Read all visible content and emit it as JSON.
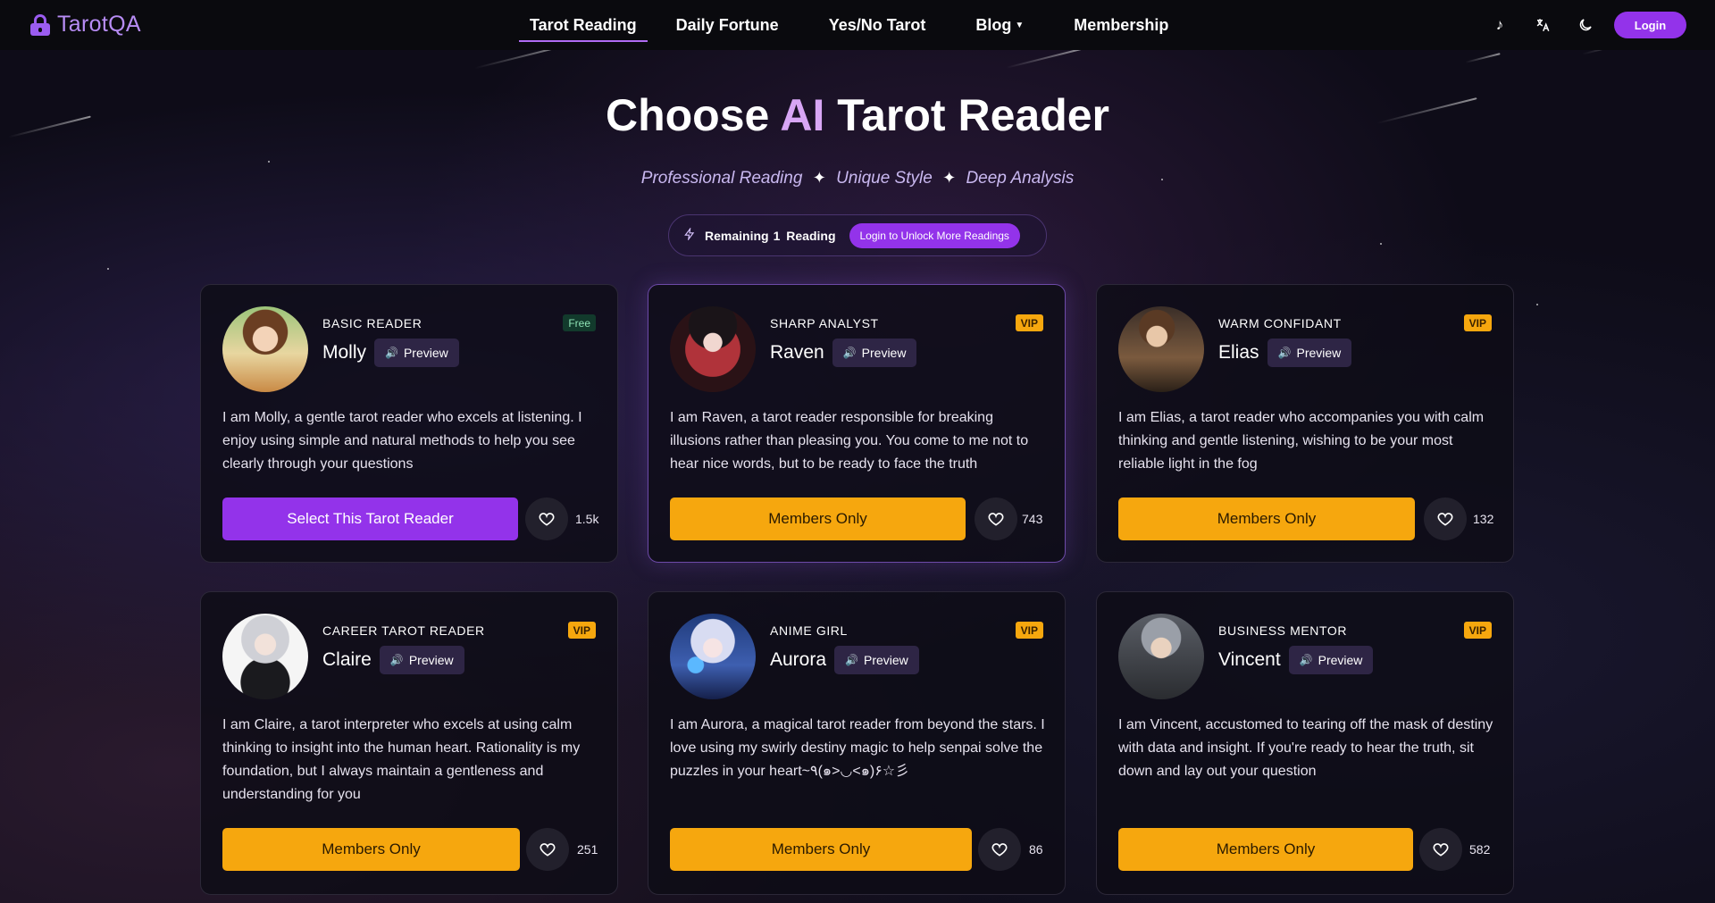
{
  "brand": {
    "name": "TarotQA"
  },
  "nav": {
    "links": [
      {
        "label": "Tarot Reading",
        "active": true
      },
      {
        "label": "Daily Fortune"
      },
      {
        "label": "Yes/No Tarot"
      },
      {
        "label": "Blog",
        "dropdown": true
      },
      {
        "label": "Membership"
      }
    ],
    "icons": [
      "music-note-icon",
      "translate-icon",
      "moon-icon"
    ],
    "login_label": "Login"
  },
  "hero": {
    "title_pre": "Choose",
    "title_accent": "AI",
    "title_post": "Tarot Reader",
    "sub_1": "Professional Reading",
    "sub_2": "Unique Style",
    "sub_3": "Deep Analysis",
    "separator": "✦",
    "remaining_label": "Remaining",
    "remaining_count": "1",
    "remaining_unit": "Reading",
    "unlock_label": "Login to Unlock More Readings"
  },
  "preview_label": "Preview",
  "readers": [
    {
      "role": "BASIC READER",
      "badge": "Free",
      "name": "Molly",
      "desc": "I am Molly, a gentle tarot reader who excels at listening. I enjoy using simple and natural methods to help you see clearly through your questions",
      "action": "Select This Tarot Reader",
      "likes": "1.5k"
    },
    {
      "role": "SHARP ANALYST",
      "badge": "VIP",
      "name": "Raven",
      "desc": "I am Raven, a tarot reader responsible for breaking illusions rather than pleasing you. You come to me not to hear nice words, but to be ready to face the truth",
      "action": "Members Only",
      "likes": "743"
    },
    {
      "role": "WARM CONFIDANT",
      "badge": "VIP",
      "name": "Elias",
      "desc": "I am Elias, a tarot reader who accompanies you with calm thinking and gentle listening, wishing to be your most reliable light in the fog",
      "action": "Members Only",
      "likes": "132"
    },
    {
      "role": "CAREER TAROT READER",
      "badge": "VIP",
      "name": "Claire",
      "desc": "I am Claire, a tarot interpreter who excels at using calm thinking to insight into the human heart. Rationality is my foundation, but I always maintain a gentleness and understanding for you",
      "action": "Members Only",
      "likes": "251"
    },
    {
      "role": "ANIME GIRL",
      "badge": "VIP",
      "name": "Aurora",
      "desc": "I am Aurora, a magical tarot reader from beyond the stars. I love using my swirly destiny magic to help senpai solve the puzzles in your heart~٩(๑>◡<๑)۶☆彡",
      "action": "Members Only",
      "likes": "86"
    },
    {
      "role": "BUSINESS MENTOR",
      "badge": "VIP",
      "name": "Vincent",
      "desc": "I am Vincent, accustomed to tearing off the mask of destiny with data and insight. If you're ready to hear the truth, sit down and lay out your question",
      "action": "Members Only",
      "likes": "582"
    }
  ],
  "colors": {
    "accent_purple": "#9333ea",
    "vip_gold": "#f6a70e",
    "free_green": "#123a2c"
  }
}
